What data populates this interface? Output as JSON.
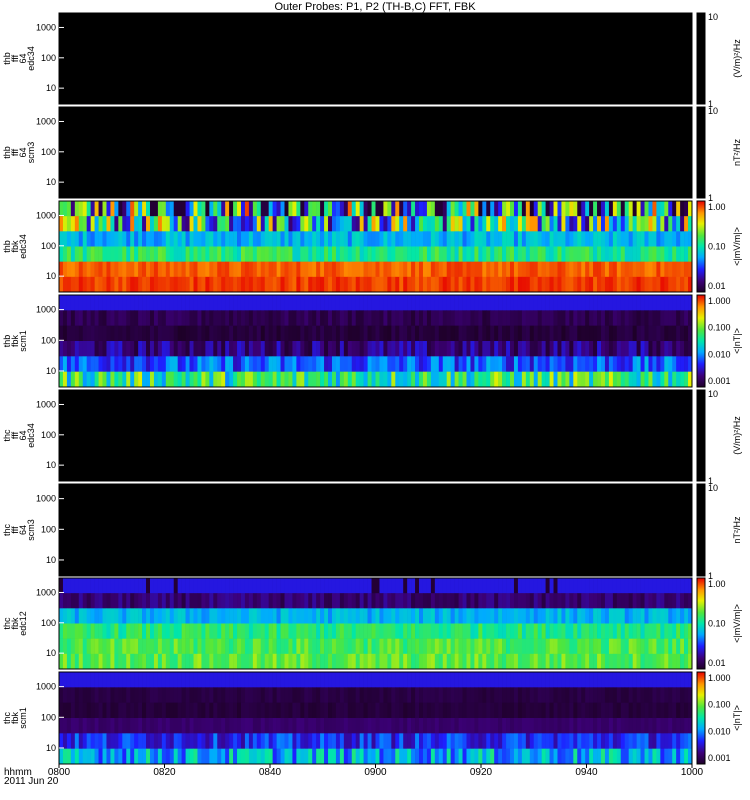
{
  "title": "Outer Probes: P1, P2 (TH-B,C) FFT, FBK",
  "x_axis": {
    "label_line1": "hhmm",
    "label_line2": "2011 Jun 20",
    "ticks": [
      "0800",
      "0820",
      "0840",
      "0900",
      "0920",
      "0940",
      "1000"
    ]
  },
  "chart_data": [
    {
      "type": "heatmap",
      "name": "thb-fff-64-edc34",
      "ylabel": [
        "thb",
        "fff",
        "64",
        "edc34"
      ],
      "yticks": [
        "1000",
        "100",
        "10"
      ],
      "yscale": "log",
      "ylim": [
        3,
        3000
      ],
      "colorbar": {
        "label": "(V/m)²/Hz",
        "ticks": [
          "10",
          "1"
        ]
      },
      "fill": "empty"
    },
    {
      "type": "heatmap",
      "name": "thb-fff-64-scm3",
      "ylabel": [
        "thb",
        "fff",
        "64",
        "scm3"
      ],
      "yticks": [
        "1000",
        "100",
        "10"
      ],
      "yscale": "log",
      "ylim": [
        3,
        3000
      ],
      "colorbar": {
        "label": "nT²/Hz",
        "ticks": [
          "10",
          "1"
        ]
      },
      "fill": "empty"
    },
    {
      "type": "heatmap",
      "name": "thb-fbk-edc34",
      "ylabel": [
        "thb",
        "fbk",
        "edc34"
      ],
      "yticks": [
        "1000",
        "100",
        "10"
      ],
      "yscale": "log",
      "ylim": [
        3,
        3000
      ],
      "colorbar": {
        "label": "<|mV/m|>",
        "ticks": [
          "1.00",
          "0.10",
          "0.01"
        ]
      },
      "bands": [
        {
          "name": "2689 Hz",
          "level": 0.45,
          "variability": 0.5,
          "dropout": 0.18
        },
        {
          "name": "572 Hz",
          "level": 0.5,
          "variability": 0.4,
          "dropout": 0.0
        },
        {
          "name": "144 Hz",
          "level": 0.4,
          "variability": 0.08,
          "dropout": 0.0
        },
        {
          "name": "36 Hz",
          "level": 0.55,
          "variability": 0.1,
          "dropout": 0.0
        },
        {
          "name": "9 Hz",
          "level": 0.92,
          "variability": 0.04,
          "dropout": 0.0
        },
        {
          "name": "2.2 Hz",
          "level": 0.95,
          "variability": 0.04,
          "dropout": 0.0
        }
      ]
    },
    {
      "type": "heatmap",
      "name": "thb-fbk-scm1",
      "ylabel": [
        "thb",
        "fbk",
        "scm1"
      ],
      "yticks": [
        "1000",
        "100",
        "10"
      ],
      "yscale": "log",
      "ylim": [
        3,
        3000
      ],
      "colorbar": {
        "label": "<|nT|>",
        "ticks": [
          "1.000",
          "0.100",
          "0.010",
          "0.001"
        ]
      },
      "bands": [
        {
          "name": "2689 Hz",
          "level": 0.22,
          "variability": 0.0,
          "dropout": 0.0
        },
        {
          "name": "572 Hz",
          "level": 0.06,
          "variability": 0.04,
          "dropout": 0.0
        },
        {
          "name": "144 Hz",
          "level": 0.03,
          "variability": 0.03,
          "dropout": 0.0
        },
        {
          "name": "36 Hz",
          "level": 0.12,
          "variability": 0.1,
          "dropout": 0.0
        },
        {
          "name": "9 Hz",
          "level": 0.3,
          "variability": 0.12,
          "dropout": 0.0
        },
        {
          "name": "2.2 Hz",
          "level": 0.55,
          "variability": 0.2,
          "dropout": 0.0
        }
      ]
    },
    {
      "type": "heatmap",
      "name": "thc-fff-64-edc34",
      "ylabel": [
        "thc",
        "fff",
        "64",
        "edc34"
      ],
      "yticks": [
        "1000",
        "100",
        "10"
      ],
      "yscale": "log",
      "ylim": [
        3,
        3000
      ],
      "colorbar": {
        "label": "(V/m)²/Hz",
        "ticks": [
          "10",
          "1"
        ]
      },
      "fill": "empty"
    },
    {
      "type": "heatmap",
      "name": "thc-fff-64-scm3",
      "ylabel": [
        "thc",
        "fff",
        "64",
        "scm3"
      ],
      "yticks": [
        "1000",
        "100",
        "10"
      ],
      "yscale": "log",
      "ylim": [
        3,
        3000
      ],
      "colorbar": {
        "label": "nT²/Hz",
        "ticks": [
          "10",
          "1"
        ]
      },
      "fill": "empty"
    },
    {
      "type": "heatmap",
      "name": "thc-fbk-edc12",
      "ylabel": [
        "thc",
        "fbk",
        "edc12"
      ],
      "yticks": [
        "1000",
        "100",
        "10"
      ],
      "yscale": "log",
      "ylim": [
        3,
        3000
      ],
      "colorbar": {
        "label": "<|mV/m|>",
        "ticks": [
          "1.00",
          "0.10",
          "0.01"
        ]
      },
      "bands": [
        {
          "name": "2689 Hz",
          "level": 0.22,
          "variability": 0.0,
          "dropout": 0.05
        },
        {
          "name": "572 Hz",
          "level": 0.1,
          "variability": 0.06,
          "dropout": 0.0
        },
        {
          "name": "144 Hz",
          "level": 0.4,
          "variability": 0.06,
          "dropout": 0.0
        },
        {
          "name": "36 Hz",
          "level": 0.55,
          "variability": 0.08,
          "dropout": 0.0
        },
        {
          "name": "9 Hz",
          "level": 0.6,
          "variability": 0.08,
          "dropout": 0.0
        },
        {
          "name": "2.2 Hz",
          "level": 0.62,
          "variability": 0.08,
          "dropout": 0.0
        }
      ]
    },
    {
      "type": "heatmap",
      "name": "thc-fbk-scm1",
      "ylabel": [
        "thc",
        "fbk",
        "scm1"
      ],
      "yticks": [
        "1000",
        "100",
        "10"
      ],
      "yscale": "log",
      "ylim": [
        3,
        3000
      ],
      "colorbar": {
        "label": "<|nT|>",
        "ticks": [
          "1.000",
          "0.100",
          "0.010",
          "0.001"
        ]
      },
      "bands": [
        {
          "name": "2689 Hz",
          "level": 0.22,
          "variability": 0.0,
          "dropout": 0.0
        },
        {
          "name": "572 Hz",
          "level": 0.04,
          "variability": 0.02,
          "dropout": 0.0
        },
        {
          "name": "144 Hz",
          "level": 0.03,
          "variability": 0.02,
          "dropout": 0.0
        },
        {
          "name": "36 Hz",
          "level": 0.1,
          "variability": 0.02,
          "dropout": 0.0
        },
        {
          "name": "9 Hz",
          "level": 0.25,
          "variability": 0.1,
          "dropout": 0.0
        },
        {
          "name": "2.2 Hz",
          "level": 0.4,
          "variability": 0.15,
          "dropout": 0.0
        }
      ]
    }
  ]
}
